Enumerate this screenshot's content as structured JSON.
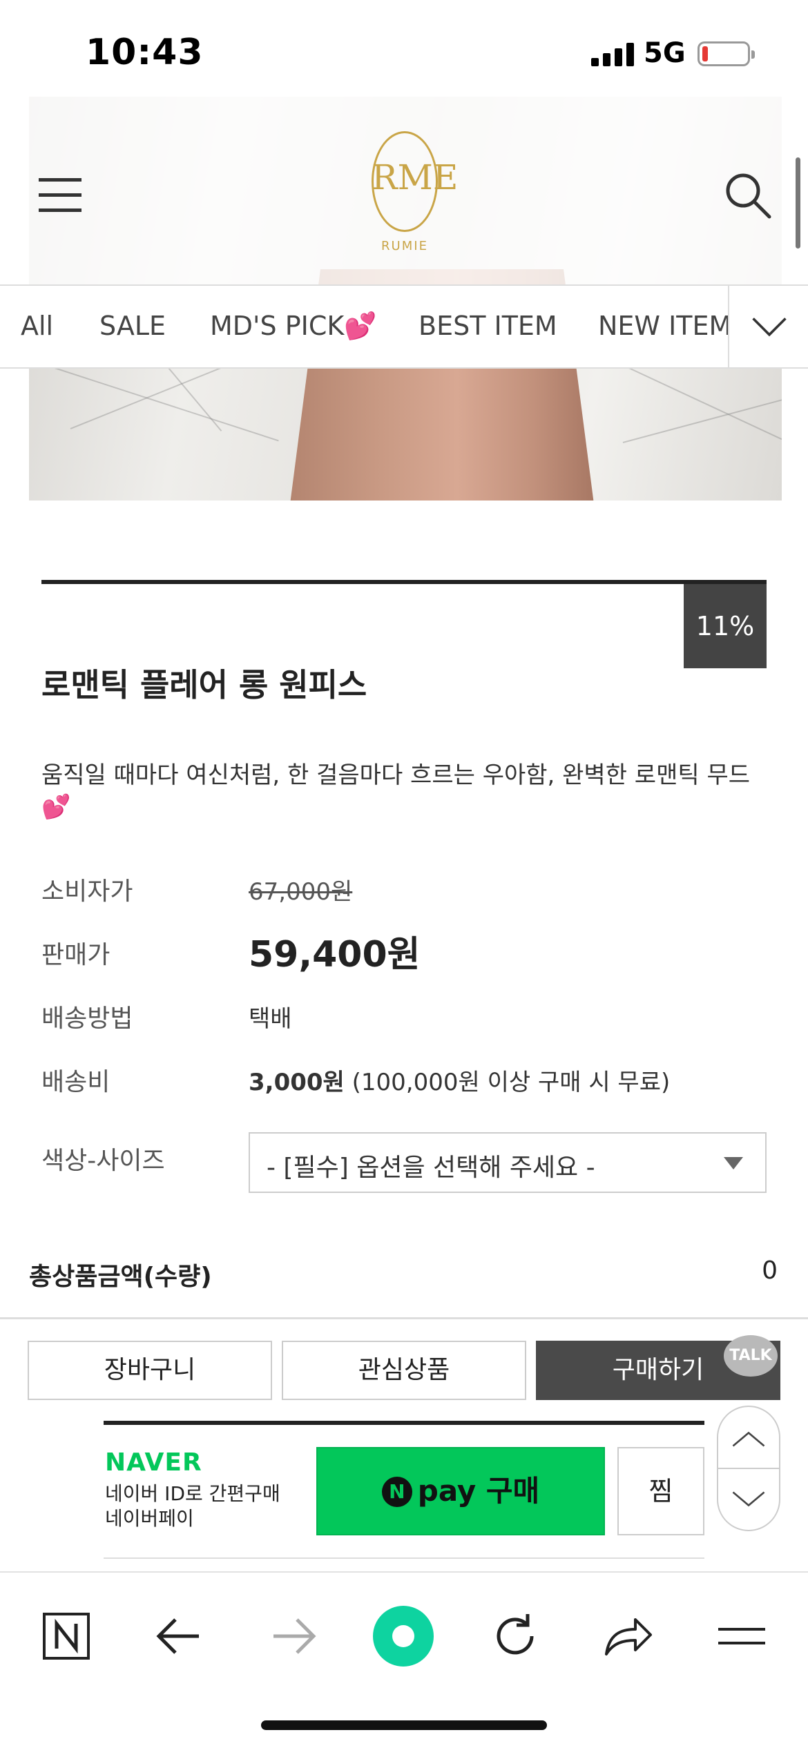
{
  "status_bar": {
    "time": "10:43",
    "network": "5G"
  },
  "header": {
    "logo_mono": "RME",
    "logo_name": "RUMIE"
  },
  "tabs": [
    "All",
    "SALE",
    "MD'S PICK💕",
    "BEST ITEM",
    "NEW ITEM"
  ],
  "product": {
    "discount": "11%",
    "title": "로맨틱 플레어 롱 원피스",
    "description": "움직일 때마다 여신처럼, 한 걸음마다 흐르는 우아함, 완벽한 로맨틱 무드 💕",
    "consumer_price_label": "소비자가",
    "consumer_price": "67,000원",
    "sale_price_label": "판매가",
    "sale_price": "59,400원",
    "shipping_method_label": "배송방법",
    "shipping_method": "택배",
    "shipping_fee_label": "배송비",
    "shipping_fee": "3,000원",
    "shipping_fee_note": "(100,000원 이상 구매 시 무료)",
    "option_label": "색상-사이즈",
    "option_placeholder": "- [필수] 옵션을 선택해 주세요 -"
  },
  "total": {
    "label": "총상품금액(수량)",
    "value": "0"
  },
  "actions": {
    "cart": "장바구니",
    "wishlist": "관심상품",
    "buy": "구매하기",
    "talk": "TALK"
  },
  "naver": {
    "logo": "NAVER",
    "sub_line1": "네이버 ID로 간편구매",
    "sub_line2": "네이버페이",
    "pay_n": "N",
    "pay_label": "pay 구매",
    "jjim": "찜"
  },
  "colors": {
    "naver_green": "#03c75a",
    "logo_gold": "#c9a547",
    "buy_button": "#4a4a4a"
  },
  "icons": [
    "menu-icon",
    "search-icon",
    "chevron-down-icon",
    "scroll-up-icon",
    "scroll-down-icon",
    "naver-n-icon",
    "back-icon",
    "forward-icon",
    "green-dot-icon",
    "reload-icon",
    "share-icon",
    "hamburger-icon"
  ]
}
